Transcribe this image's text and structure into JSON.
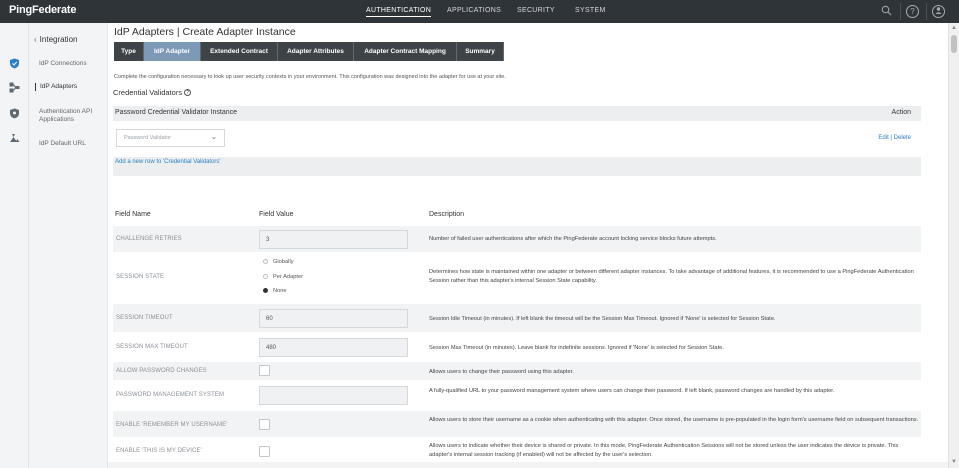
{
  "app": {
    "logo": "PingFederate"
  },
  "topnav": {
    "items": [
      "AUTHENTICATION",
      "APPLICATIONS",
      "SECURITY",
      "SYSTEM"
    ],
    "active": "AUTHENTICATION",
    "icons": [
      "search-icon",
      "help-icon",
      "user-icon"
    ]
  },
  "rail": {
    "icons": [
      "shield-icon",
      "applications-icon",
      "security-icon",
      "system-icon"
    ],
    "active_color": "#2a7fc4"
  },
  "sidebar": {
    "back_label": "Integration",
    "items": [
      {
        "label": "IdP Connections"
      },
      {
        "label": "IdP Adapters"
      },
      {
        "label": "Authentication API Applications"
      },
      {
        "label": "IdP Default URL"
      }
    ],
    "active_index": 1
  },
  "page": {
    "title": "IdP Adapters | Create Adapter Instance",
    "tabs": [
      "Type",
      "IdP Adapter",
      "Extended Contract",
      "Adapter Attributes",
      "Adapter Contract Mapping",
      "Summary"
    ],
    "active_tab": "IdP Adapter",
    "intro": "Complete the configuration necessary to look up user security contexts in your environment. This configuration was designed into the adapter for use at your site."
  },
  "credential_validators": {
    "title": "Credential Validators",
    "help_icon": "?",
    "column_instance": "Password Credential Validator Instance",
    "column_action": "Action",
    "select_placeholder": "Password Validator",
    "action_links": "Edit | Delete",
    "add_row": "Add a new row to 'Credential Validators'"
  },
  "fields": {
    "headers": {
      "name": "Field Name",
      "value": "Field Value",
      "description": "Description"
    },
    "challenge_retries": {
      "name": "CHALLENGE RETRIES",
      "value": "3",
      "desc": "Number of failed user authentications after which the PingFederate account locking service blocks future attempts."
    },
    "session_state": {
      "name": "SESSION STATE",
      "options": [
        "Globally",
        "Per Adapter",
        "None"
      ],
      "selected": "None",
      "desc": "Determines how state is maintained within one adapter or between different adapter instances. To take advantage of additional features, it is recommended to use a PingFederate Authentication Session rather than this adapter's internal Session State capability."
    },
    "session_timeout": {
      "name": "SESSION TIMEOUT",
      "value": "60",
      "desc": "Session Idle Timeout (in minutes). If left blank the timeout will be the Session Max Timeout. Ignored if 'None' is selected for Session State."
    },
    "session_max_timeout": {
      "name": "SESSION MAX TIMEOUT",
      "value": "480",
      "desc": "Session Max Timeout (in minutes). Leave blank for indefinite sessions. Ignored if 'None' is selected for Session State."
    },
    "allow_password_changes": {
      "name": "ALLOW PASSWORD CHANGES",
      "desc": "Allows users to change their password using this adapter."
    },
    "password_management_system": {
      "name": "PASSWORD MANAGEMENT SYSTEM",
      "value": "",
      "desc": "A fully-qualified URL to your password management system where users can change their password. If left blank, password changes are handled by this adapter."
    },
    "remember_username": {
      "name": "ENABLE 'REMEMBER MY USERNAME'",
      "desc": "Allows users to store their username as a cookie when authenticating with this adapter. Once stored, the username is pre-populated in the login form's username field on subsequent transactions."
    },
    "this_is_my_device": {
      "name": "ENABLE 'THIS IS MY DEVICE'",
      "desc": "Allows users to indicate whether their device is shared or private. In this mode, PingFederate Authentication Sessions will not be stored unless the user indicates the device is private. This adapter's internal session tracking (if enabled) will not be affected by the user's selection."
    }
  }
}
